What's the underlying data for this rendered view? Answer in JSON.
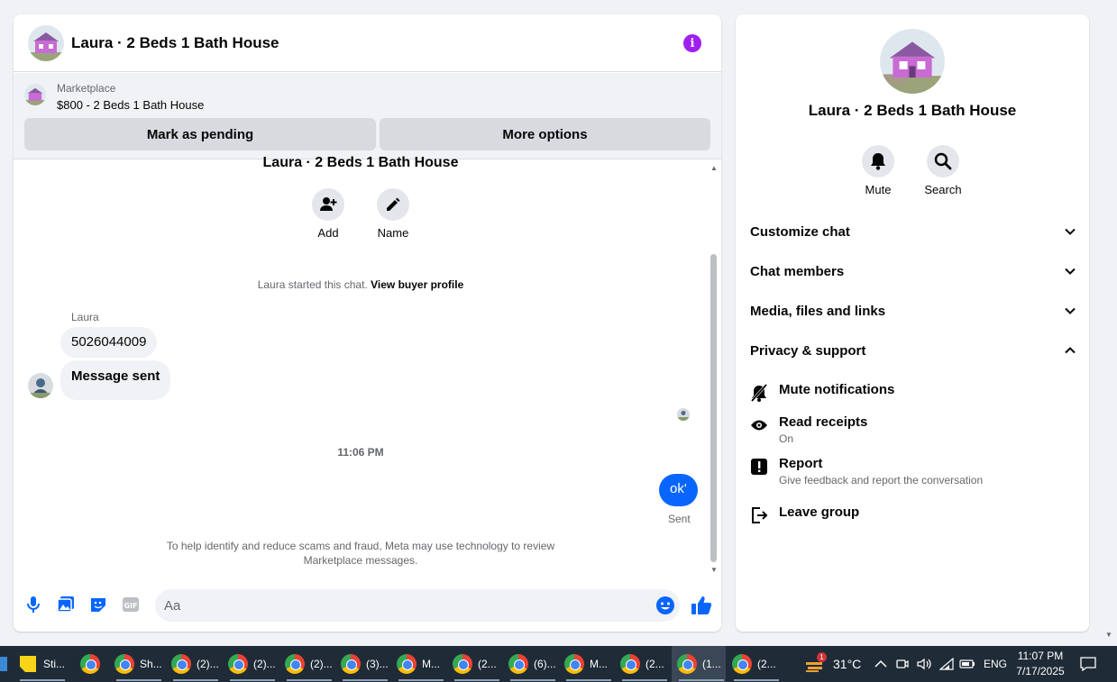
{
  "chat": {
    "title": "Laura · 2 Beds 1 Bath House",
    "marketplace": {
      "label": "Marketplace",
      "listing": "$800 - 2 Beds 1 Bath House",
      "mark_pending": "Mark as pending",
      "more_options": "More options"
    },
    "thread_title": "Laura · 2 Beds 1 Bath House",
    "add_label": "Add",
    "name_label": "Name",
    "started_text": "Laura started this chat.",
    "buyer_profile_link": "View buyer profile",
    "sender_name": "Laura",
    "incoming": [
      "5026044009",
      "Message sent"
    ],
    "timestamp": "11:06 PM",
    "outgoing": "ok'",
    "sent_status": "Sent",
    "disclaimer": "To help identify and reduce scams and fraud, Meta may use technology to review Marketplace messages.",
    "composer_placeholder": "Aa"
  },
  "info": {
    "title": "Laura · 2 Beds 1 Bath House",
    "mute_label": "Mute",
    "search_label": "Search",
    "sections": [
      "Customize chat",
      "Chat members",
      "Media, files and links",
      "Privacy & support"
    ],
    "privacy": {
      "mute_notifications": "Mute notifications",
      "read_receipts": "Read receipts",
      "read_receipts_status": "On",
      "report": "Report",
      "report_desc": "Give feedback and report the conversation",
      "leave_group": "Leave group"
    }
  },
  "taskbar": {
    "items": [
      "Sti...",
      "Sh...",
      "(2)...",
      "(2)...",
      "(2)...",
      "(3)...",
      "M...",
      "(2...",
      "(6)...",
      "M...",
      "(2...",
      "(1...",
      "(2..."
    ],
    "weather": "31°C",
    "weather_badge": "1",
    "language": "ENG",
    "time": "11:07 PM",
    "date": "7/17/2025"
  },
  "colors": {
    "accent": "#0866ff",
    "info_purple": "#a020f0",
    "house_pink": "#c86bd4"
  }
}
